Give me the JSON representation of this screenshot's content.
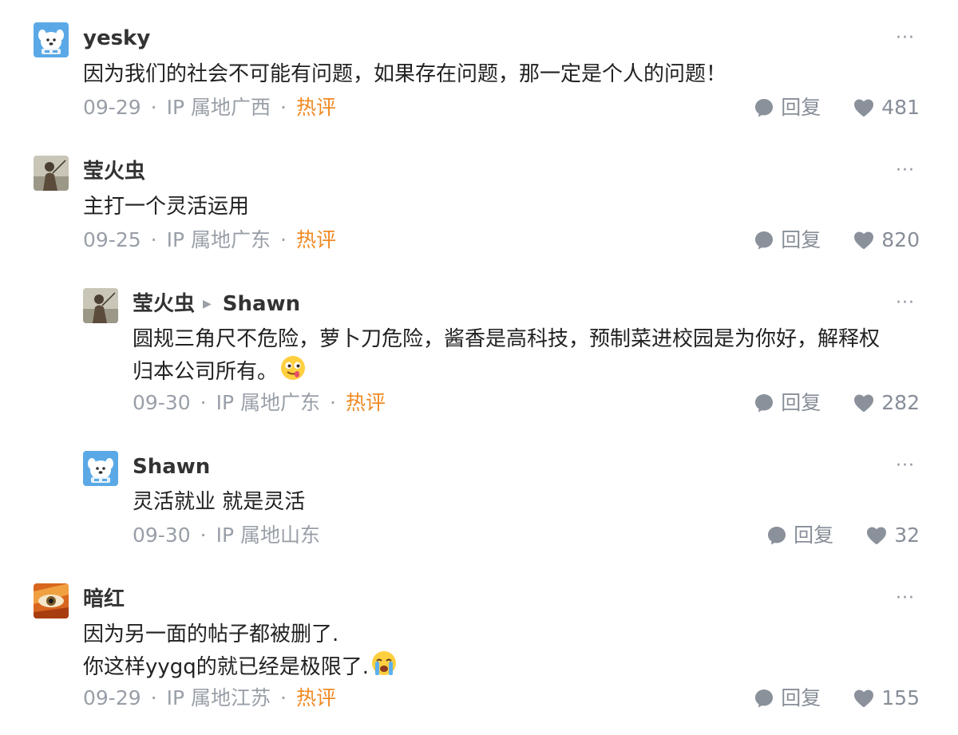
{
  "ui": {
    "more_label": "···",
    "reply_label": "回复",
    "separator": "·",
    "hot_label": "热评"
  },
  "comments": [
    {
      "user": "yesky",
      "text": "因为我们的社会不可能有问题，如果存在问题，那一定是个人的问题！",
      "date": "09-29",
      "ip": "IP 属地广西",
      "likes": "481",
      "avatar": "dog-avatar"
    },
    {
      "user": "莹火虫",
      "text": "主打一个灵活运用",
      "date": "09-25",
      "ip": "IP 属地广东",
      "likes": "820",
      "avatar": "person-avatar"
    },
    {
      "user": "莹火虫",
      "reply_to": "Shawn",
      "text": "圆规三角尺不危险，萝卜刀危险，酱香是高科技，预制菜进校园是为你好，解释权\n归本公司所有。",
      "emoji": "drooling-face-emoji",
      "date": "09-30",
      "ip": "IP 属地广东",
      "likes": "282",
      "avatar": "person-avatar"
    },
    {
      "user": "Shawn",
      "text": "灵活就业 就是灵活",
      "date": "09-30",
      "ip": "IP 属地山东",
      "likes": "32",
      "avatar": "dog-avatar"
    },
    {
      "user": "暗红",
      "text": "因为另一面的帖子都被删了.\n你这样yygq的就已经是极限了.",
      "emoji": "crying-face-emoji",
      "date": "09-29",
      "ip": "IP 属地江苏",
      "likes": "155",
      "avatar": "eye-avatar"
    }
  ],
  "colors": {
    "hot": "#f08a24",
    "meta": "#999fa8",
    "icon": "#8a919b"
  }
}
